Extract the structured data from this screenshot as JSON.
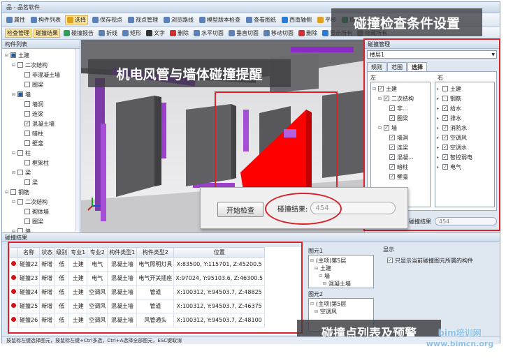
{
  "window": {
    "title": "品 - 品茗软件"
  },
  "toolbar1": [
    {
      "icon": "property-icon",
      "label": "属性"
    },
    {
      "icon": "component-list-icon",
      "label": "构件列表"
    },
    {
      "icon": "select-icon",
      "label": "选择"
    },
    {
      "icon": "save-view-icon",
      "label": "保存视点"
    },
    {
      "icon": "view-manager-icon",
      "label": "视点管理"
    },
    {
      "icon": "roaming-icon",
      "label": "浏览路线"
    },
    {
      "icon": "model-version-icon",
      "label": "模型版本检查"
    },
    {
      "icon": "drawing-icon",
      "label": "查看图纸"
    },
    {
      "icon": "view-direction-icon",
      "label": "西南轴侧"
    },
    {
      "icon": "pan-icon",
      "label": "平移"
    },
    {
      "icon": "rotate-icon",
      "label": "旋转"
    }
  ],
  "toolbar2": [
    {
      "label": "检查管理"
    },
    {
      "label": "碰撞结果"
    },
    {
      "icon": "report-icon",
      "label": "碰撞报告"
    },
    {
      "icon": "polyline-icon",
      "label": "折线"
    },
    {
      "icon": "rectangle-icon",
      "label": "矩形"
    },
    {
      "icon": "text-icon",
      "label": "文字"
    },
    {
      "icon": "delete-icon",
      "label": "删除"
    },
    {
      "icon": "horizontal-cut-icon",
      "label": "水平切面"
    },
    {
      "icon": "vertical-cut-icon",
      "label": "垂直切面"
    },
    {
      "icon": "move-cut-icon",
      "label": "移动切面"
    },
    {
      "icon": "delete-icon",
      "label": "删除"
    },
    {
      "icon": "show-all-icon",
      "label": "显示所有"
    },
    {
      "icon": "hide-all-icon",
      "label": "隐藏所有"
    }
  ],
  "component_panel": {
    "title": "构件列表",
    "items": [
      {
        "label": "土建",
        "depth": 0,
        "exp": "▪",
        "check": "▪"
      },
      {
        "label": "二次结构",
        "depth": 1,
        "exp": "▪",
        "check": ""
      },
      {
        "label": "非混凝土墙",
        "depth": 2,
        "exp": "",
        "check": ""
      },
      {
        "label": "圈梁",
        "depth": 2,
        "exp": "",
        "check": ""
      },
      {
        "label": "墙",
        "depth": 1,
        "exp": "▪",
        "check": "▪"
      },
      {
        "label": "墙洞",
        "depth": 2,
        "exp": "",
        "check": ""
      },
      {
        "label": "连梁",
        "depth": 2,
        "exp": "",
        "check": ""
      },
      {
        "label": "混凝土墙",
        "depth": 2,
        "exp": "",
        "check": "✓"
      },
      {
        "label": "暗柱",
        "depth": 2,
        "exp": "",
        "check": ""
      },
      {
        "label": "壁龛",
        "depth": 2,
        "exp": "",
        "check": ""
      },
      {
        "label": "柱",
        "depth": 1,
        "exp": "▪",
        "check": ""
      },
      {
        "label": "框架柱",
        "depth": 2,
        "exp": "",
        "check": ""
      },
      {
        "label": "梁",
        "depth": 1,
        "exp": "▪",
        "check": ""
      },
      {
        "label": "梁",
        "depth": 2,
        "exp": "",
        "check": ""
      },
      {
        "label": "钢筋",
        "depth": 0,
        "exp": "▪",
        "check": ""
      },
      {
        "label": "二次结构",
        "depth": 1,
        "exp": "▪",
        "check": ""
      },
      {
        "label": "砌体墙",
        "depth": 2,
        "exp": "",
        "check": ""
      },
      {
        "label": "圈梁",
        "depth": 2,
        "exp": "",
        "check": ""
      },
      {
        "label": "墙",
        "depth": 1,
        "exp": "▪",
        "check": ""
      }
    ]
  },
  "annotations": {
    "viewport_banner": "机电风管与墙体碰撞提醒",
    "conditions_banner": "碰撞检查条件设置",
    "results_banner": "碰撞点列表及预警"
  },
  "collision_panel": {
    "title": "碰撞管理",
    "scope_value": "楼层1",
    "tabs": [
      "规则",
      "范围",
      "选择"
    ],
    "active_tab": 2,
    "left_label": "左",
    "right_label": "右",
    "left_items": [
      {
        "label": "土建",
        "depth": 0,
        "check": "✓"
      },
      {
        "label": "二次结构",
        "depth": 1,
        "check": "✓"
      },
      {
        "label": "非...",
        "depth": 2,
        "check": "✓"
      },
      {
        "label": "圈梁",
        "depth": 2,
        "check": "✓"
      },
      {
        "label": "墙",
        "depth": 1,
        "check": "✓"
      },
      {
        "label": "墙洞",
        "depth": 2,
        "check": "✓"
      },
      {
        "label": "连梁",
        "depth": 2,
        "check": "✓"
      },
      {
        "label": "混凝...",
        "depth": 2,
        "check": "✓"
      },
      {
        "label": "暗柱",
        "depth": 2,
        "check": "✓"
      },
      {
        "label": "壁龛",
        "depth": 2,
        "check": "✓"
      }
    ],
    "right_items": [
      {
        "label": "土建",
        "check": ""
      },
      {
        "label": "钢筋",
        "check": ""
      },
      {
        "label": "给水",
        "check": "✓"
      },
      {
        "label": "排水",
        "check": "✓"
      },
      {
        "label": "消防水",
        "check": "✓"
      },
      {
        "label": "空调风",
        "check": "✓"
      },
      {
        "label": "空调水",
        "check": "✓"
      },
      {
        "label": "智控弱电",
        "check": "✓"
      },
      {
        "label": "电气",
        "check": "✓"
      }
    ],
    "result_label": "碰撞结果",
    "result_value": "454"
  },
  "callout": {
    "start_button": "开始检查",
    "result_label": "碰撞结果:",
    "result_value": "454"
  },
  "results": {
    "title": "碰撞结果",
    "columns": [
      "",
      "名称",
      "状态",
      "级别",
      "专业1",
      "专业2",
      "构件类型1",
      "构件类型2",
      "位置"
    ],
    "rows": [
      [
        "碰撞22",
        "新增",
        "低",
        "土建",
        "电气",
        "混凝土墙",
        "电气照明灯具",
        "X:83500, Y:115701, Z:45200.5"
      ],
      [
        "碰撞23",
        "新增",
        "低",
        "土建",
        "电气",
        "混凝土墙",
        "电气开关插座",
        "X:97024, Y:95103.6, Z:46300.5"
      ],
      [
        "碰撞24",
        "新增",
        "低",
        "土建",
        "空调风",
        "混凝土墙",
        "管道",
        "X:100312, Y:94503.7, Z:48825"
      ],
      [
        "碰撞25",
        "新增",
        "低",
        "土建",
        "空调风",
        "混凝土墙",
        "管道",
        "X:100312, Y:94503.7, Z:46375"
      ],
      [
        "碰撞26",
        "新增",
        "低",
        "土建",
        "空调风",
        "混凝土墙",
        "风管通头",
        "X:100312, Y:94503.7, Z:48100"
      ]
    ],
    "element1_title": "图元1",
    "element1_items": [
      "(主项)第5层",
      "土建",
      "墙",
      "混凝土墙"
    ],
    "element2_title": "图元2",
    "element2_items": [
      "(主项)第5层",
      "空调风"
    ],
    "display_title": "显示",
    "only_current_label": "只显示当前碰撞图元所属的构件"
  },
  "status_bar": "按鼠标左键选择图元，按鼠标左键+Ctrl多选，Ctrl+A选择全部图元，ESC键取消",
  "watermark": {
    "brand": "bim培训网",
    "url": "www.bimcn.org"
  },
  "colors": {
    "highlight_red": "#ff0000",
    "duct_purple": "#8a2bc8",
    "annotation_red": "#d8232a"
  }
}
